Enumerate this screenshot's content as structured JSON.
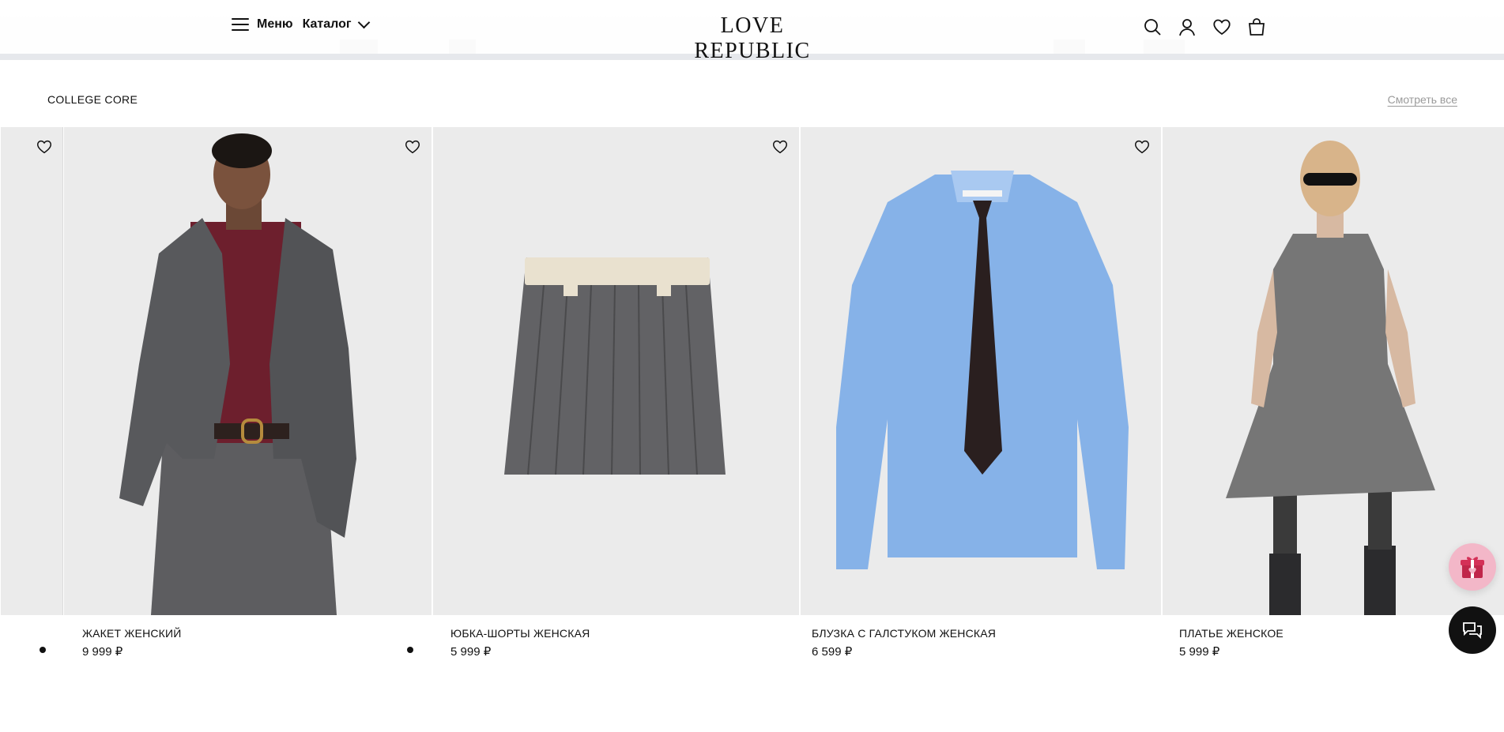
{
  "header": {
    "menu_label": "Меню",
    "catalog_label": "Каталог",
    "logo": "LOVE REPUBLIC"
  },
  "section": {
    "title": "COLLEGE CORE",
    "see_all": "Смотреть все"
  },
  "products": [
    {
      "name": "ЖАКЕТ ЖЕНСКИЙ",
      "price": "9 999 ₽"
    },
    {
      "name": "ЮБКА-ШОРТЫ ЖЕНСКАЯ",
      "price": "5 999 ₽"
    },
    {
      "name": "БЛУЗКА С ГАЛСТУКОМ ЖЕНСКАЯ",
      "price": "6 599 ₽"
    },
    {
      "name": "ПЛАТЬЕ ЖЕНСКОЕ",
      "price": "5 999 ₽"
    }
  ],
  "colors": {
    "accent_gift": "#f3b7c8",
    "chat": "#111111",
    "muted_link": "#9a9a9a"
  },
  "icons": [
    "menu-icon",
    "chevron-down-icon",
    "search-icon",
    "user-icon",
    "heart-icon",
    "bag-icon",
    "gift-icon",
    "chat-icon"
  ]
}
